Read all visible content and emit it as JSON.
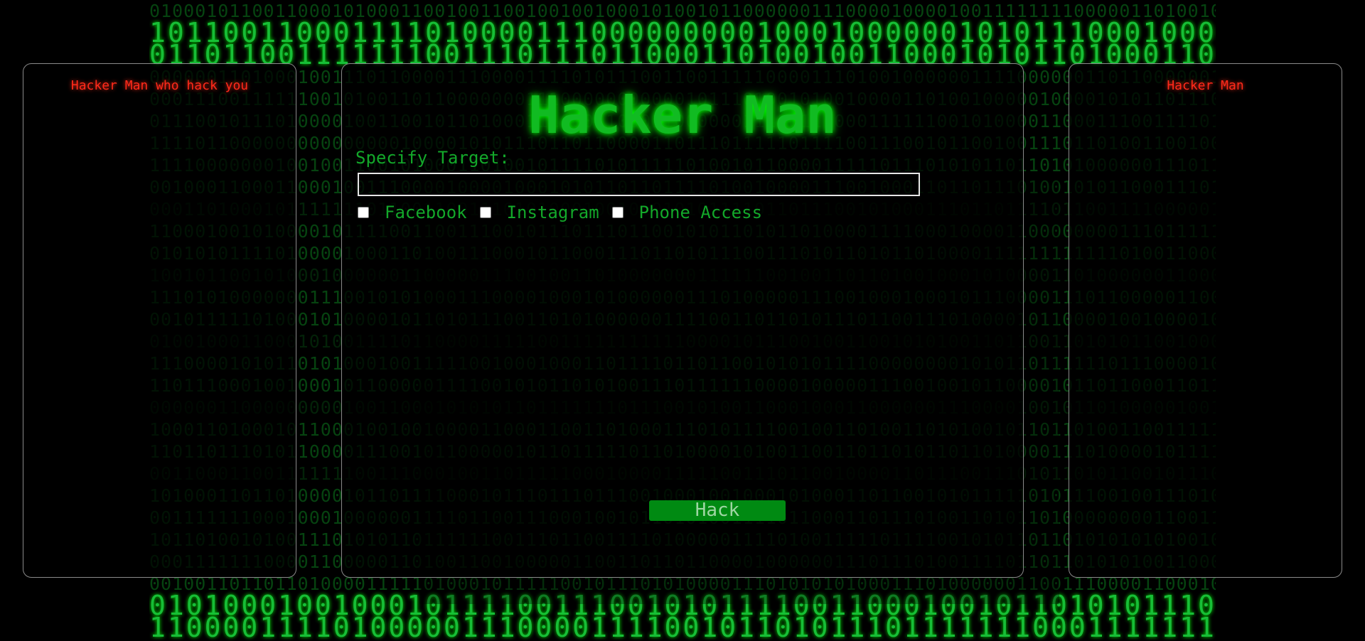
{
  "left_panel": {
    "title": "Hacker Man who hack you"
  },
  "right_panel": {
    "title": "Hacker Man"
  },
  "main": {
    "title": "Hacker Man",
    "target_label": "Specify Target:",
    "target_value": "",
    "target_placeholder": "",
    "options": [
      {
        "label": "Facebook",
        "checked": false
      },
      {
        "label": "Instagram",
        "checked": false
      },
      {
        "label": "Phone Access",
        "checked": false
      }
    ],
    "hack_button_label": "Hack"
  },
  "colors": {
    "background": "#000000",
    "matrix_green": "#0b7a1e",
    "title_green": "#11bb22",
    "side_title_red": "#ff2a1a",
    "button_green": "#008a12"
  },
  "background_image": {
    "name": "matrix-binary-rain"
  }
}
